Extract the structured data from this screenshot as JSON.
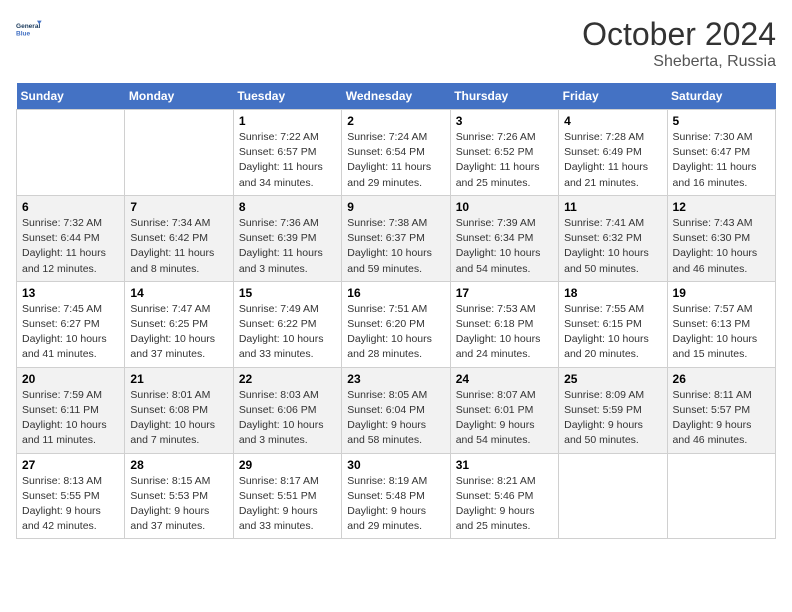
{
  "header": {
    "logo_line1": "General",
    "logo_line2": "Blue",
    "month": "October 2024",
    "location": "Sheberta, Russia"
  },
  "weekdays": [
    "Sunday",
    "Monday",
    "Tuesday",
    "Wednesday",
    "Thursday",
    "Friday",
    "Saturday"
  ],
  "weeks": [
    [
      {
        "day": "",
        "sunrise": "",
        "sunset": "",
        "daylight": ""
      },
      {
        "day": "",
        "sunrise": "",
        "sunset": "",
        "daylight": ""
      },
      {
        "day": "1",
        "sunrise": "Sunrise: 7:22 AM",
        "sunset": "Sunset: 6:57 PM",
        "daylight": "Daylight: 11 hours and 34 minutes."
      },
      {
        "day": "2",
        "sunrise": "Sunrise: 7:24 AM",
        "sunset": "Sunset: 6:54 PM",
        "daylight": "Daylight: 11 hours and 29 minutes."
      },
      {
        "day": "3",
        "sunrise": "Sunrise: 7:26 AM",
        "sunset": "Sunset: 6:52 PM",
        "daylight": "Daylight: 11 hours and 25 minutes."
      },
      {
        "day": "4",
        "sunrise": "Sunrise: 7:28 AM",
        "sunset": "Sunset: 6:49 PM",
        "daylight": "Daylight: 11 hours and 21 minutes."
      },
      {
        "day": "5",
        "sunrise": "Sunrise: 7:30 AM",
        "sunset": "Sunset: 6:47 PM",
        "daylight": "Daylight: 11 hours and 16 minutes."
      }
    ],
    [
      {
        "day": "6",
        "sunrise": "Sunrise: 7:32 AM",
        "sunset": "Sunset: 6:44 PM",
        "daylight": "Daylight: 11 hours and 12 minutes."
      },
      {
        "day": "7",
        "sunrise": "Sunrise: 7:34 AM",
        "sunset": "Sunset: 6:42 PM",
        "daylight": "Daylight: 11 hours and 8 minutes."
      },
      {
        "day": "8",
        "sunrise": "Sunrise: 7:36 AM",
        "sunset": "Sunset: 6:39 PM",
        "daylight": "Daylight: 11 hours and 3 minutes."
      },
      {
        "day": "9",
        "sunrise": "Sunrise: 7:38 AM",
        "sunset": "Sunset: 6:37 PM",
        "daylight": "Daylight: 10 hours and 59 minutes."
      },
      {
        "day": "10",
        "sunrise": "Sunrise: 7:39 AM",
        "sunset": "Sunset: 6:34 PM",
        "daylight": "Daylight: 10 hours and 54 minutes."
      },
      {
        "day": "11",
        "sunrise": "Sunrise: 7:41 AM",
        "sunset": "Sunset: 6:32 PM",
        "daylight": "Daylight: 10 hours and 50 minutes."
      },
      {
        "day": "12",
        "sunrise": "Sunrise: 7:43 AM",
        "sunset": "Sunset: 6:30 PM",
        "daylight": "Daylight: 10 hours and 46 minutes."
      }
    ],
    [
      {
        "day": "13",
        "sunrise": "Sunrise: 7:45 AM",
        "sunset": "Sunset: 6:27 PM",
        "daylight": "Daylight: 10 hours and 41 minutes."
      },
      {
        "day": "14",
        "sunrise": "Sunrise: 7:47 AM",
        "sunset": "Sunset: 6:25 PM",
        "daylight": "Daylight: 10 hours and 37 minutes."
      },
      {
        "day": "15",
        "sunrise": "Sunrise: 7:49 AM",
        "sunset": "Sunset: 6:22 PM",
        "daylight": "Daylight: 10 hours and 33 minutes."
      },
      {
        "day": "16",
        "sunrise": "Sunrise: 7:51 AM",
        "sunset": "Sunset: 6:20 PM",
        "daylight": "Daylight: 10 hours and 28 minutes."
      },
      {
        "day": "17",
        "sunrise": "Sunrise: 7:53 AM",
        "sunset": "Sunset: 6:18 PM",
        "daylight": "Daylight: 10 hours and 24 minutes."
      },
      {
        "day": "18",
        "sunrise": "Sunrise: 7:55 AM",
        "sunset": "Sunset: 6:15 PM",
        "daylight": "Daylight: 10 hours and 20 minutes."
      },
      {
        "day": "19",
        "sunrise": "Sunrise: 7:57 AM",
        "sunset": "Sunset: 6:13 PM",
        "daylight": "Daylight: 10 hours and 15 minutes."
      }
    ],
    [
      {
        "day": "20",
        "sunrise": "Sunrise: 7:59 AM",
        "sunset": "Sunset: 6:11 PM",
        "daylight": "Daylight: 10 hours and 11 minutes."
      },
      {
        "day": "21",
        "sunrise": "Sunrise: 8:01 AM",
        "sunset": "Sunset: 6:08 PM",
        "daylight": "Daylight: 10 hours and 7 minutes."
      },
      {
        "day": "22",
        "sunrise": "Sunrise: 8:03 AM",
        "sunset": "Sunset: 6:06 PM",
        "daylight": "Daylight: 10 hours and 3 minutes."
      },
      {
        "day": "23",
        "sunrise": "Sunrise: 8:05 AM",
        "sunset": "Sunset: 6:04 PM",
        "daylight": "Daylight: 9 hours and 58 minutes."
      },
      {
        "day": "24",
        "sunrise": "Sunrise: 8:07 AM",
        "sunset": "Sunset: 6:01 PM",
        "daylight": "Daylight: 9 hours and 54 minutes."
      },
      {
        "day": "25",
        "sunrise": "Sunrise: 8:09 AM",
        "sunset": "Sunset: 5:59 PM",
        "daylight": "Daylight: 9 hours and 50 minutes."
      },
      {
        "day": "26",
        "sunrise": "Sunrise: 8:11 AM",
        "sunset": "Sunset: 5:57 PM",
        "daylight": "Daylight: 9 hours and 46 minutes."
      }
    ],
    [
      {
        "day": "27",
        "sunrise": "Sunrise: 8:13 AM",
        "sunset": "Sunset: 5:55 PM",
        "daylight": "Daylight: 9 hours and 42 minutes."
      },
      {
        "day": "28",
        "sunrise": "Sunrise: 8:15 AM",
        "sunset": "Sunset: 5:53 PM",
        "daylight": "Daylight: 9 hours and 37 minutes."
      },
      {
        "day": "29",
        "sunrise": "Sunrise: 8:17 AM",
        "sunset": "Sunset: 5:51 PM",
        "daylight": "Daylight: 9 hours and 33 minutes."
      },
      {
        "day": "30",
        "sunrise": "Sunrise: 8:19 AM",
        "sunset": "Sunset: 5:48 PM",
        "daylight": "Daylight: 9 hours and 29 minutes."
      },
      {
        "day": "31",
        "sunrise": "Sunrise: 8:21 AM",
        "sunset": "Sunset: 5:46 PM",
        "daylight": "Daylight: 9 hours and 25 minutes."
      },
      {
        "day": "",
        "sunrise": "",
        "sunset": "",
        "daylight": ""
      },
      {
        "day": "",
        "sunrise": "",
        "sunset": "",
        "daylight": ""
      }
    ]
  ]
}
